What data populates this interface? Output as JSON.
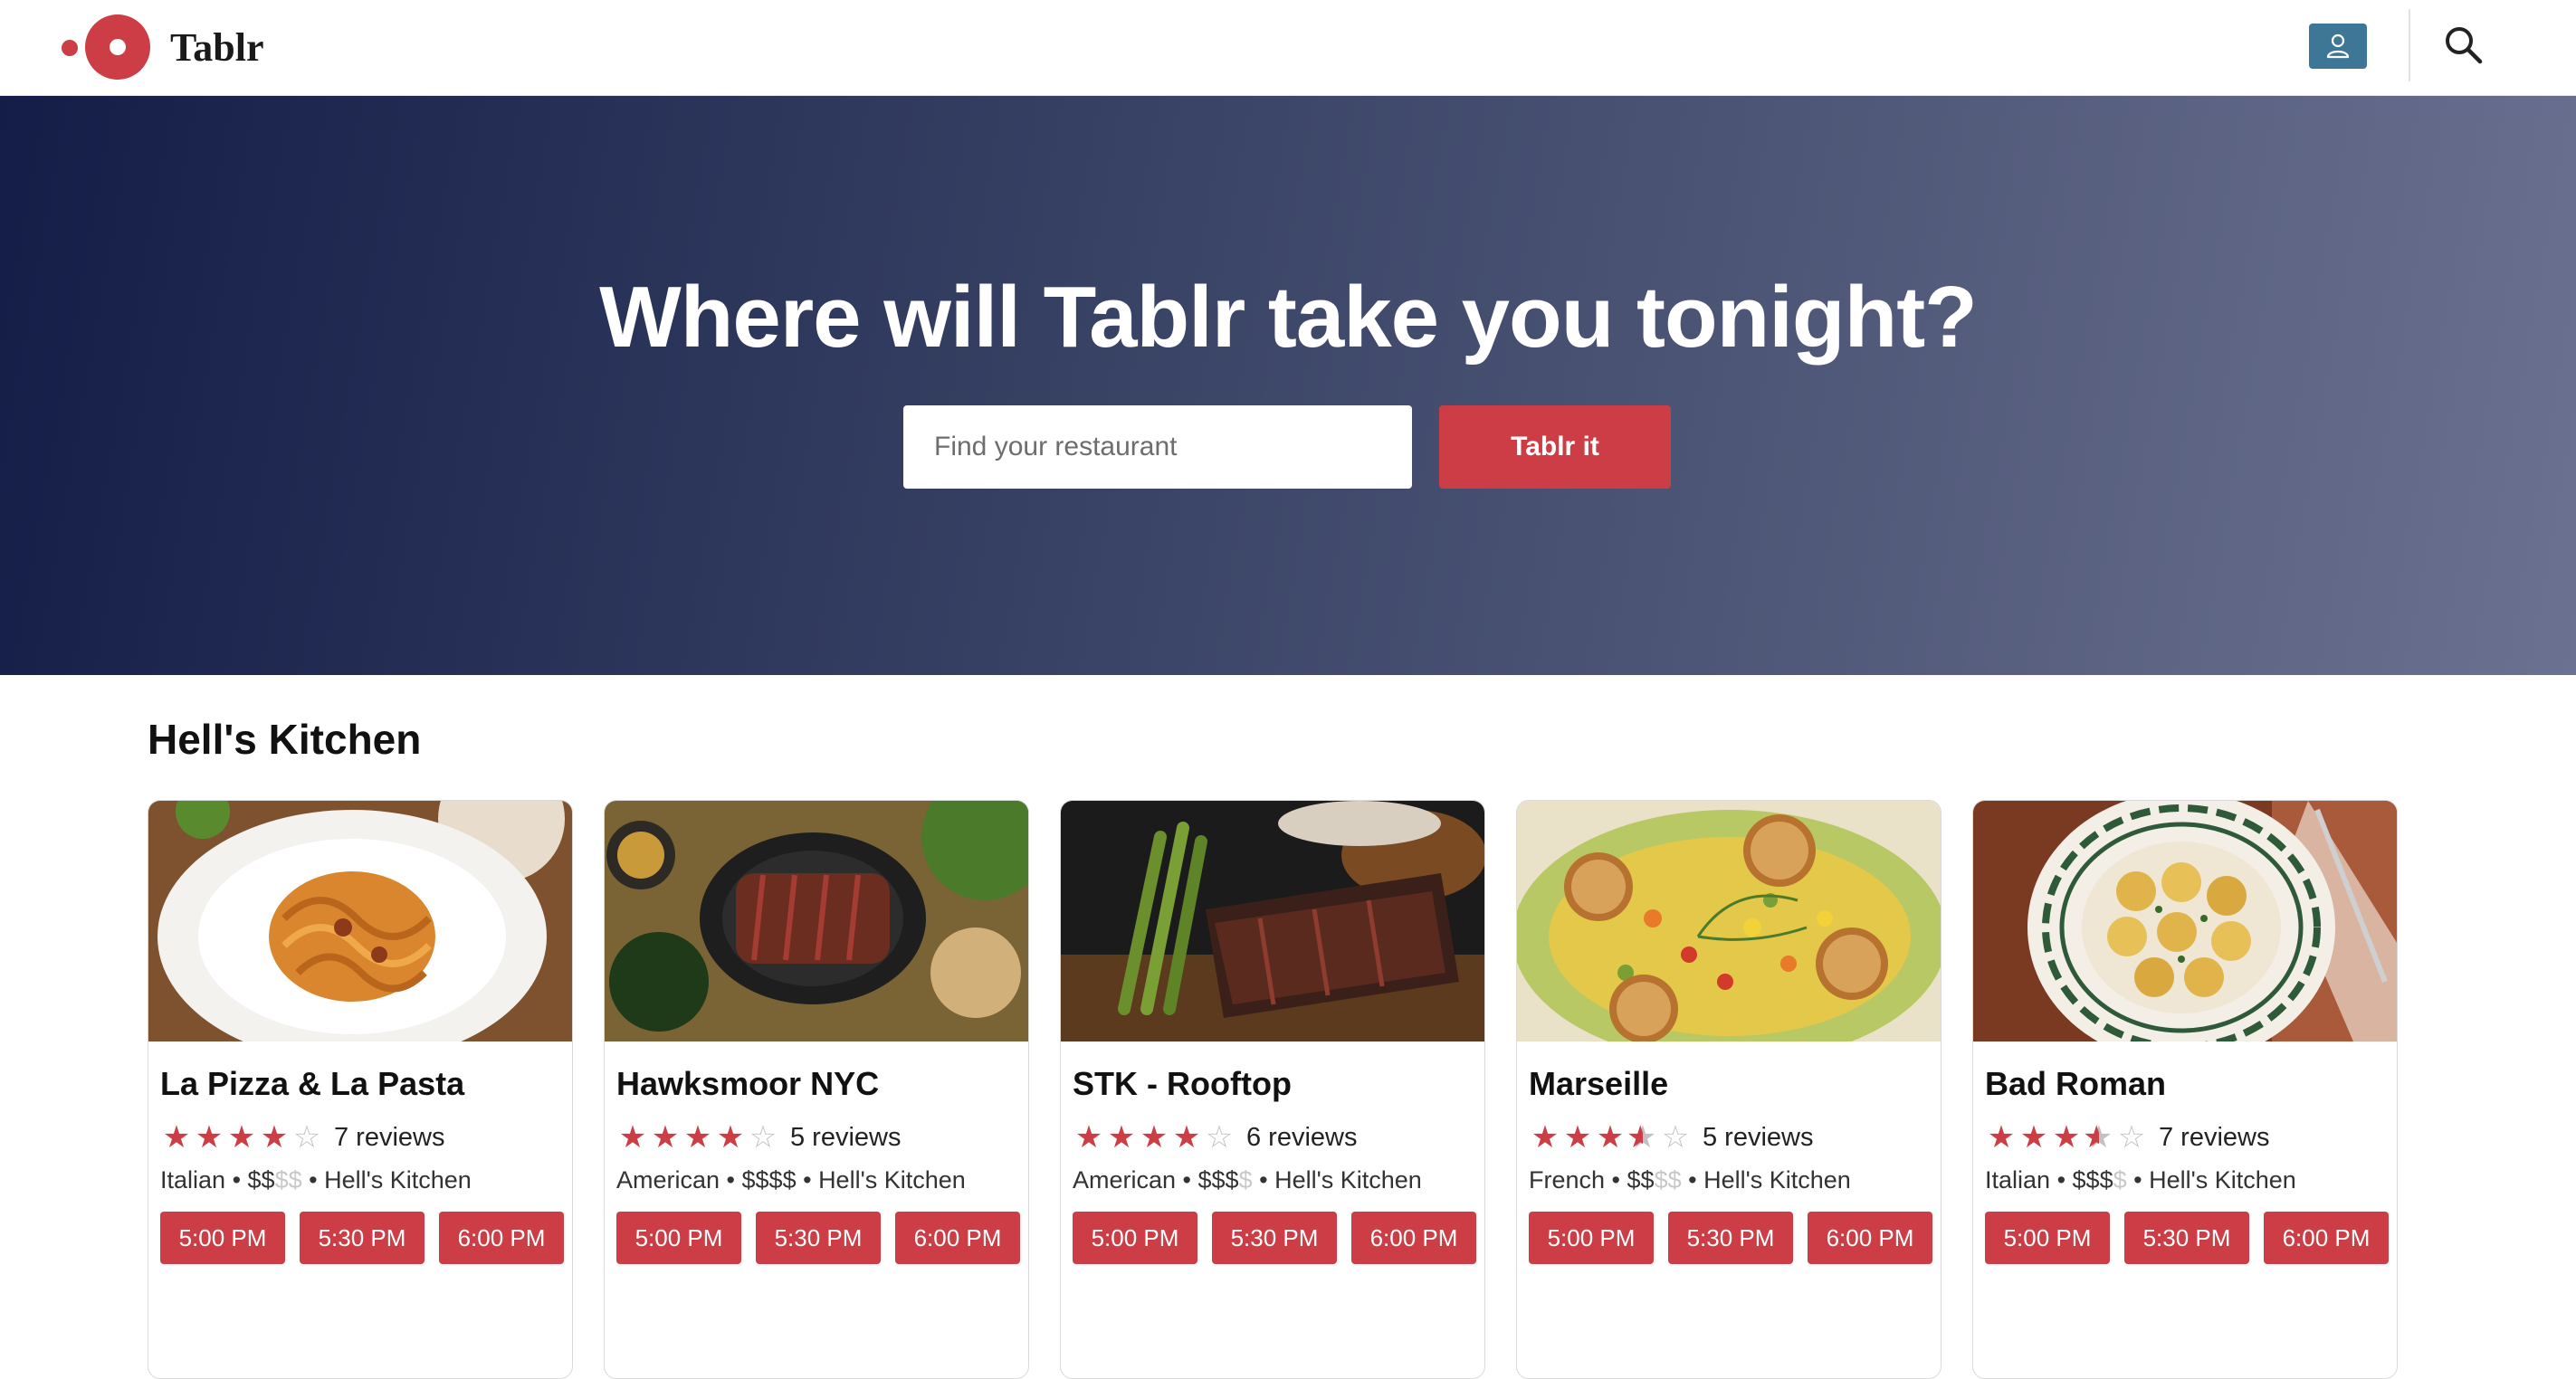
{
  "brand": {
    "name": "Tablr",
    "accent": "#cc3d45"
  },
  "nav": {
    "user_icon": "user-icon",
    "search_icon": "search-icon"
  },
  "hero": {
    "title": "Where will Tablr take you tonight?",
    "search_placeholder": "Find your restaurant",
    "button_label": "Tablr it"
  },
  "section": {
    "title": "Hell's Kitchen"
  },
  "restaurants": [
    {
      "name": "La Pizza & La Pasta",
      "rating": 4,
      "reviews": "7 reviews",
      "cuisine": "Italian",
      "price_on": "$$",
      "price_off": "$$",
      "neighborhood": "Hell's Kitchen",
      "times": [
        "5:00 PM",
        "5:30 PM",
        "6:00 PM"
      ]
    },
    {
      "name": "Hawksmoor NYC",
      "rating": 4,
      "reviews": "5 reviews",
      "cuisine": "American",
      "price_on": "$$$$",
      "price_off": "",
      "neighborhood": "Hell's Kitchen",
      "times": [
        "5:00 PM",
        "5:30 PM",
        "6:00 PM"
      ]
    },
    {
      "name": "STK - Rooftop",
      "rating": 4,
      "reviews": "6 reviews",
      "cuisine": "American",
      "price_on": "$$$",
      "price_off": "$",
      "neighborhood": "Hell's Kitchen",
      "times": [
        "5:00 PM",
        "5:30 PM",
        "6:00 PM"
      ]
    },
    {
      "name": "Marseille",
      "rating": 3.5,
      "reviews": "5 reviews",
      "cuisine": "French",
      "price_on": "$$",
      "price_off": "$$",
      "neighborhood": "Hell's Kitchen",
      "times": [
        "5:00 PM",
        "5:30 PM",
        "6:00 PM"
      ]
    },
    {
      "name": "Bad Roman",
      "rating": 3.5,
      "reviews": "7 reviews",
      "cuisine": "Italian",
      "price_on": "$$$",
      "price_off": "$",
      "neighborhood": "Hell's Kitchen",
      "times": [
        "5:00 PM",
        "5:30 PM",
        "6:00 PM"
      ]
    }
  ]
}
